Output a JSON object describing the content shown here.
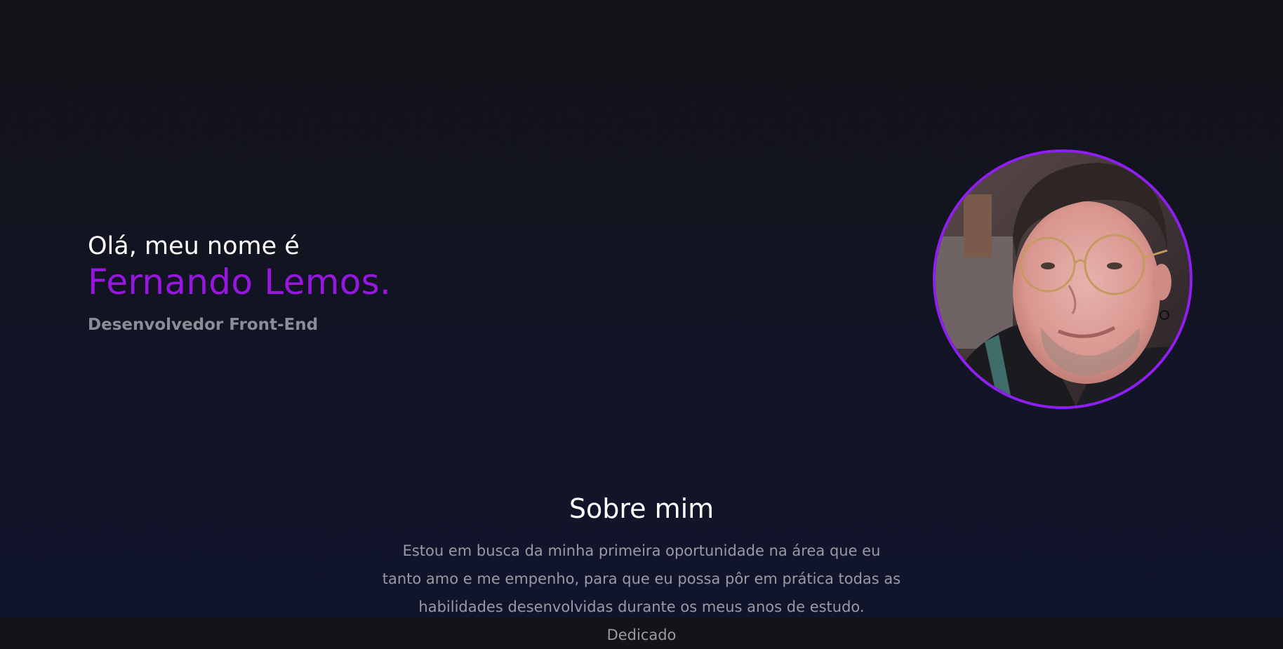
{
  "hero": {
    "greeting": "Olá, meu nome é",
    "name": "Fernando Lemos.",
    "role": "Desenvolvedor Front-End",
    "accent_color": "#9717e0"
  },
  "profile_photo": {
    "alt": "Fernando Lemos",
    "border_color": "#8f1ff0"
  },
  "about": {
    "title": "Sobre mim",
    "text": "Estou em busca da minha primeira oportunidade na área que eu tanto amo e me empenho, para que eu possa pôr em prática todas as habilidades desenvolvidas durante os meus anos de estudo. Dedicado"
  }
}
